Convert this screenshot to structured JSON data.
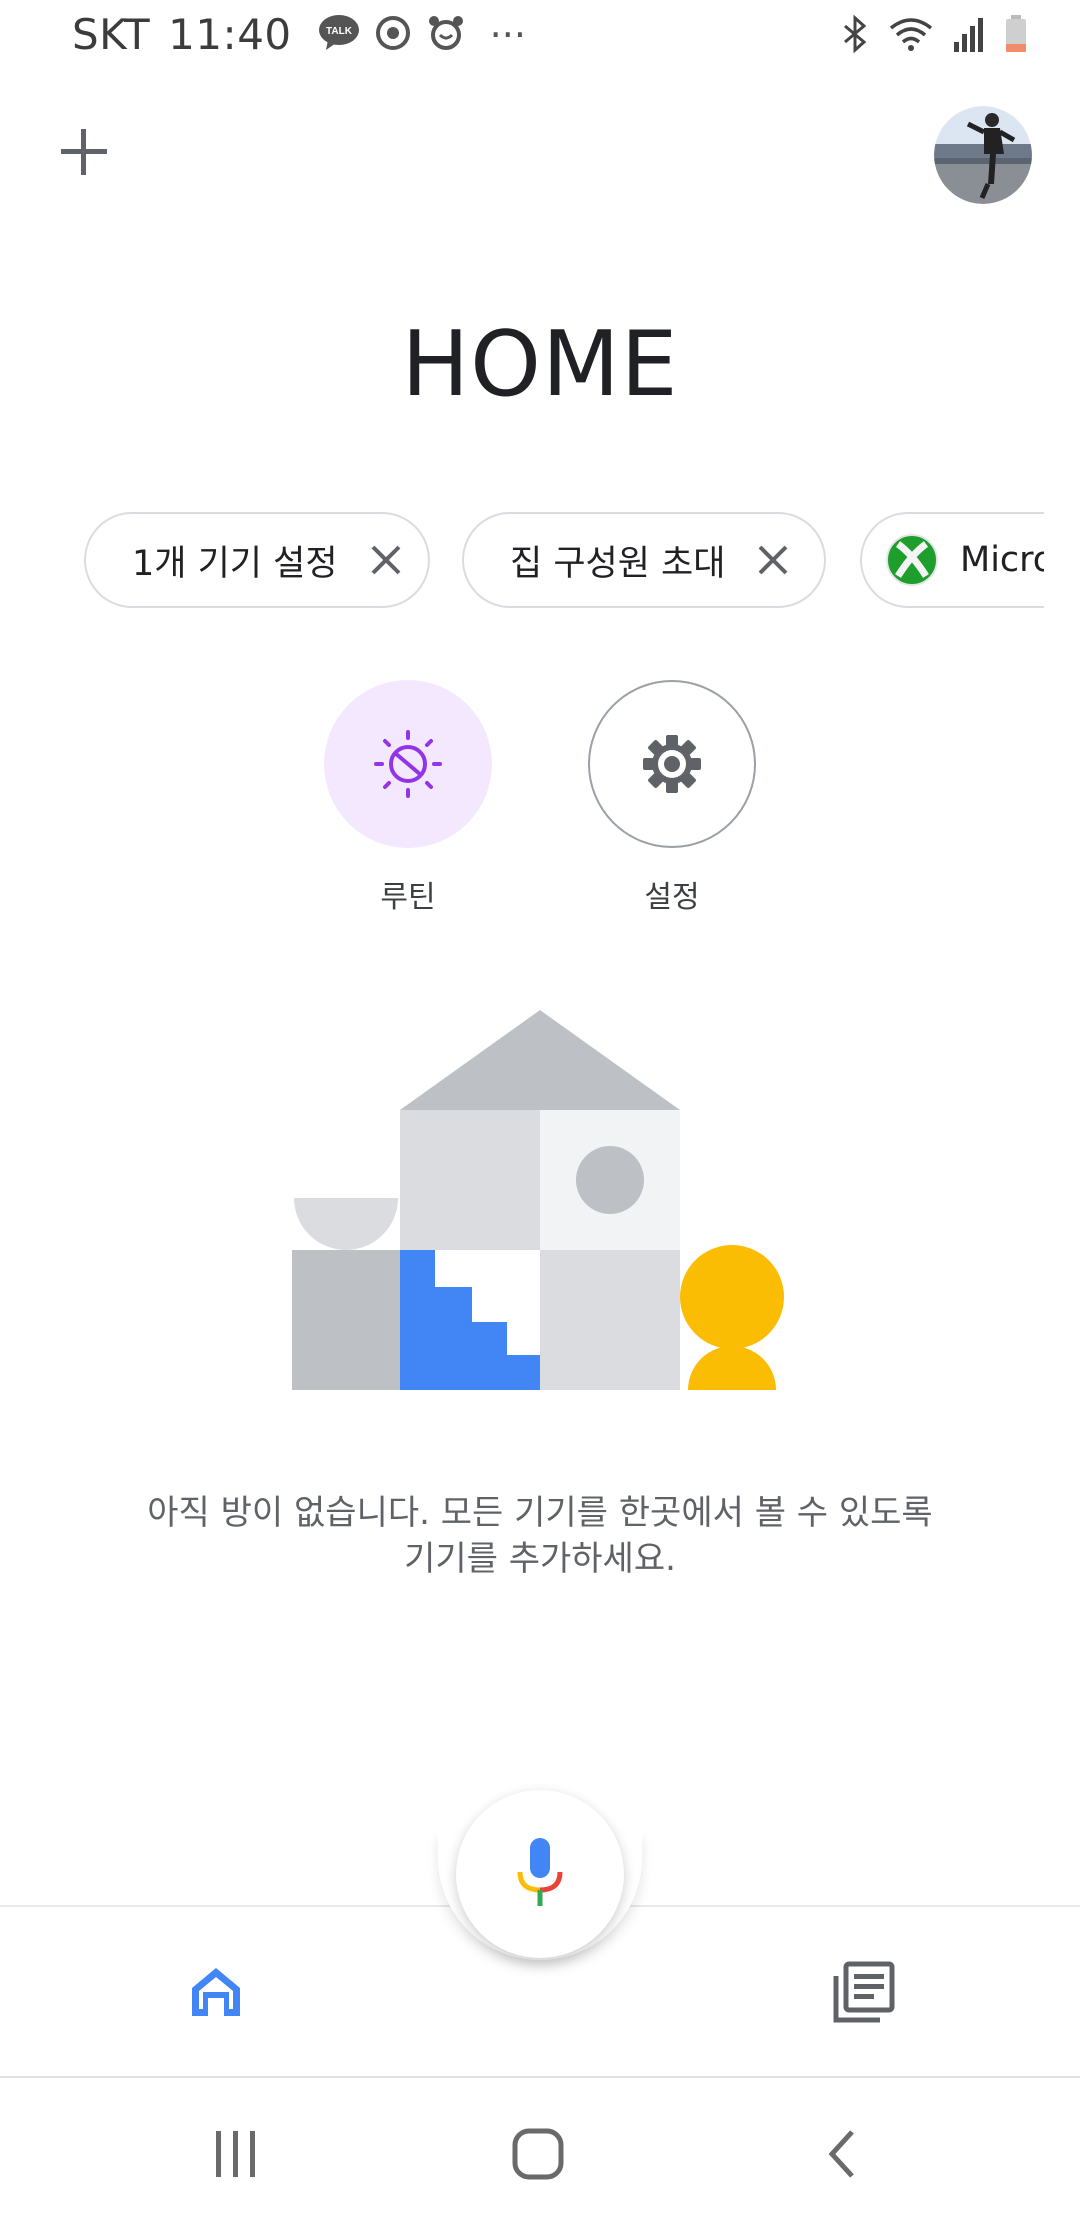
{
  "status_bar": {
    "carrier": "SKT",
    "time": "11:40",
    "notification_icons": [
      "kakaotalk-icon",
      "sync-icon",
      "alarm-icon",
      "more-dots-icon"
    ],
    "system_icons": [
      "bluetooth-icon",
      "wifi-icon",
      "signal-icon",
      "battery-icon"
    ],
    "talk_badge": "TALK",
    "more": "···"
  },
  "header": {
    "add_icon": "plus-icon",
    "avatar": "user-avatar"
  },
  "page_title": "HOME",
  "chips": [
    {
      "label": "1개 기기 설정",
      "icon": "close-icon"
    },
    {
      "label": "집 구성원 초대",
      "icon": "close-icon"
    },
    {
      "label": "Micro",
      "icon": "xbox-logo-icon"
    }
  ],
  "actions": [
    {
      "label": "루틴",
      "icon": "routine-sun-icon",
      "bg": "#f3e8fd",
      "accent": "#9334e6"
    },
    {
      "label": "설정",
      "icon": "gear-icon",
      "bg": "#ffffff",
      "accent": "#5f6368"
    }
  ],
  "empty_state": {
    "message": "아직 방이 없습니다. 모든 기기를 한곳에서 볼 수 있도록 기기를 추가하세요."
  },
  "bottom_nav": {
    "items": [
      {
        "name": "home",
        "icon": "home-icon",
        "active": true
      },
      {
        "name": "feed",
        "icon": "feed-icon",
        "active": false
      }
    ],
    "mic_icon": "mic-icon"
  },
  "system_nav": {
    "items": [
      "recent-apps-icon",
      "home-circle-icon",
      "back-icon"
    ]
  },
  "colors": {
    "blue": "#4285f4",
    "yellow": "#fbbc04",
    "red": "#ea4335",
    "green": "#34a853",
    "purple": "#9334e6",
    "gray": "#bdc1c6"
  }
}
